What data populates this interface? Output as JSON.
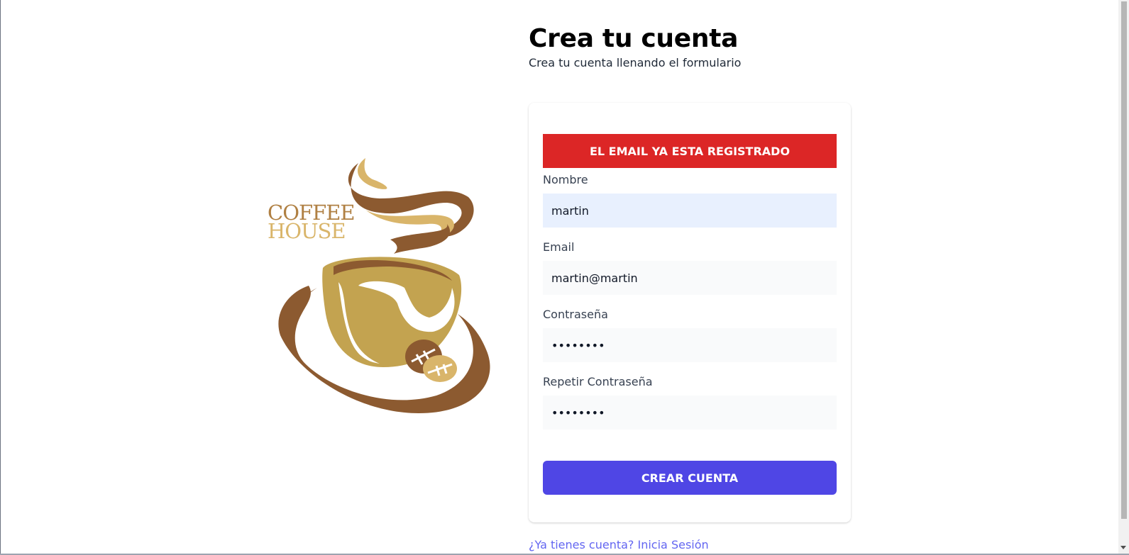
{
  "logo": {
    "text_line1": "COFFEE",
    "text_line2": "HOUSE",
    "icon": "coffee-cup-icon",
    "colors": {
      "brown": "#8c5a30",
      "gold": "#c3a350",
      "light_gold": "#d9b56a"
    }
  },
  "header": {
    "title": "Crea tu cuenta",
    "subtitle": "Crea tu cuenta llenando el formulario"
  },
  "form": {
    "alert": {
      "message": "EL EMAIL YA ESTA REGISTRADO",
      "color": "#dc2626"
    },
    "fields": {
      "nombre": {
        "label": "Nombre",
        "value": "martin"
      },
      "email": {
        "label": "Email",
        "value": "martin@martin"
      },
      "password": {
        "label": "Contraseña",
        "value": "••••••••"
      },
      "repeat_password": {
        "label": "Repetir Contraseña",
        "value": "••••••••"
      }
    },
    "submit_label": "CREAR CUENTA",
    "accent_color": "#4f46e5"
  },
  "footer": {
    "login_link": "¿Ya tienes cuenta? Inicia Sesión"
  }
}
